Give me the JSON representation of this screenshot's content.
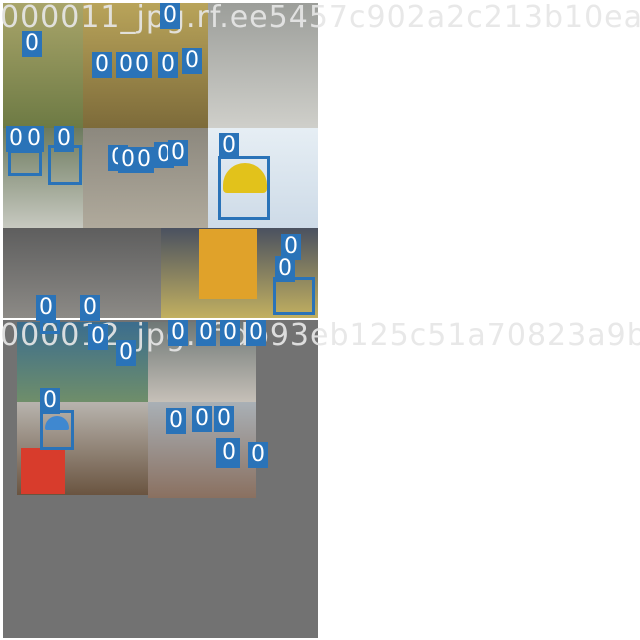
{
  "panels": [
    {
      "title": "000011_jpg.rf.ee5457c902a2c213b10ea",
      "class_label": "0"
    },
    {
      "title": "000012_jpg.rf.db93eb125c51a70823a9b",
      "class_label": "0"
    }
  ],
  "colors": {
    "box": "#2a73b8",
    "padding": "#727272",
    "background": "#ffffff"
  }
}
